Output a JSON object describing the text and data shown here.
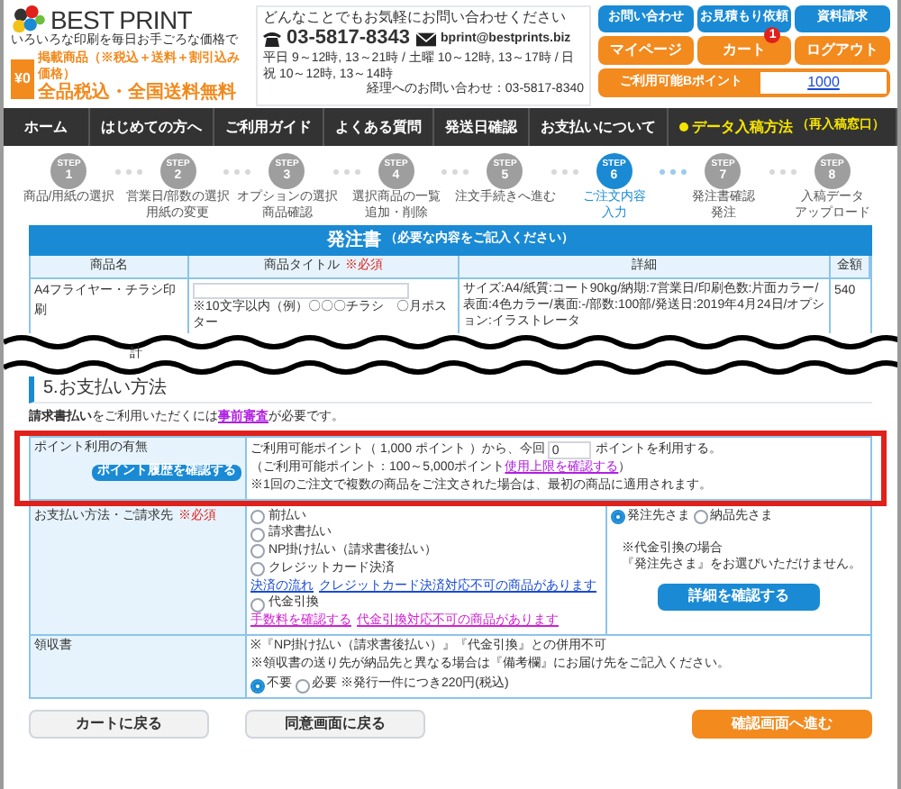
{
  "header": {
    "brand_first": "BEST",
    "brand_second": "PRINT",
    "tagline": "いろいろな印刷を毎日お手ごろな価格で",
    "badge": "¥0",
    "promo_small": "掲載商品（※税込＋送料＋割引込み価格）",
    "promo": "全品税込・全国送料無料"
  },
  "contact": {
    "headline": "どんなことでもお気軽にお問い合わせください",
    "phone": "03-5817-8343",
    "email": "bprint@bestprints.biz",
    "hours": "平日 9～12時, 13～21時 / 土曜 10～12時, 13～17時 / 日祝 10～12時, 13～14時",
    "accounting": "経理へのお問い合わせ：03-5817-8340"
  },
  "top_buttons": [
    {
      "label": "お問い合わせ",
      "kind": "blue"
    },
    {
      "label": "お見積もり依頼",
      "kind": "blue"
    },
    {
      "label": "資料請求",
      "kind": "blue"
    },
    {
      "label": "マイページ",
      "kind": "orange"
    },
    {
      "label": "カート",
      "kind": "orange",
      "badge": "1"
    },
    {
      "label": "ログアウト",
      "kind": "orange"
    }
  ],
  "points": {
    "label": "ご利用可能Bポイント",
    "value": "1000"
  },
  "nav": [
    {
      "label": "ホーム",
      "kind": "normal"
    },
    {
      "label": "はじめての方へ",
      "kind": "normal"
    },
    {
      "label": "ご利用ガイド",
      "kind": "normal"
    },
    {
      "label": "よくある質問",
      "kind": "normal"
    },
    {
      "label": "発送日確認",
      "kind": "normal"
    },
    {
      "label": "お支払いについて",
      "kind": "normal"
    },
    {
      "label": "データ入稿方法",
      "kind": "highlight",
      "sub": "（再入稿窓口）"
    }
  ],
  "steps": [
    {
      "label": "STEP",
      "number": "1",
      "caption": [
        "商品/用紙の選択"
      ],
      "selected": false
    },
    {
      "label": "STEP",
      "number": "2",
      "caption": [
        "営業日/部数の選択",
        "用紙の変更"
      ],
      "selected": false
    },
    {
      "label": "STEP",
      "number": "3",
      "caption": [
        "オプションの選択",
        "商品確認"
      ],
      "selected": false
    },
    {
      "label": "STEP",
      "number": "4",
      "caption": [
        "選択商品の一覧",
        "追加・削除"
      ],
      "selected": false
    },
    {
      "label": "STEP",
      "number": "5",
      "caption": [
        "注文手続きへ進む"
      ],
      "selected": false
    },
    {
      "label": "STEP",
      "number": "6",
      "caption": [
        "ご注文内容",
        "入力"
      ],
      "selected": true
    },
    {
      "label": "STEP",
      "number": "7",
      "caption": [
        "発注書確認",
        "発注"
      ],
      "selected": false
    },
    {
      "label": "STEP",
      "number": "8",
      "caption": [
        "入稿データ",
        "アップロード"
      ],
      "selected": false
    }
  ],
  "order_form": {
    "title": "発注書",
    "subtitle": "（必要な内容をご記入ください）",
    "columns": [
      {
        "label": "商品名"
      },
      {
        "label": "商品タイトル",
        "required": "※必須"
      },
      {
        "label": "詳細"
      },
      {
        "label": "金額"
      }
    ],
    "rows": [
      {
        "product": "A4フライヤー・チラシ印刷",
        "hint": "※10文字以内（例）〇〇〇チラシ　〇月ポスター",
        "details": "サイズ:A4/紙質:コート90kg/納期:7営業日/印刷色数:片面カラー/表面:4色カラー/裏面:-/部数:100部/発送日:2019年4月24日/オプション:イラストレータ",
        "amount": "540"
      }
    ],
    "total_label": "計"
  },
  "payment": {
    "section_title": "5.お支払い方法",
    "notice": {
      "text": "**請求書払い**をご利用いただくには",
      "link": "事前審査",
      "after": "が必要です。"
    },
    "points_row": {
      "label": "ポイント利用の有無",
      "history_button": "ポイント履歴を確認する",
      "use_before": "ご利用可能ポイント（ 1,000 ポイント ）から、今回",
      "use_value": "0",
      "use_after": "ポイントを利用する。",
      "range": "（ご利用可能ポイント：100～5,000ポイント",
      "range_link": "使用上限を確認する",
      "range_end": "）",
      "note": "※1回のご注文で複数の商品をご注文された場合は、最初の商品に適用されます。"
    },
    "method_row": {
      "label": "お支払い方法・ご請求先",
      "required": "※必須",
      "items": [
        {
          "kind": "radio",
          "label": "前払い",
          "selected": false
        },
        {
          "kind": "radio",
          "label": "請求書払い",
          "selected": false
        },
        {
          "kind": "radio",
          "label": "NP掛け払い（請求書後払い）",
          "selected": false
        },
        {
          "kind": "radio",
          "label": "クレジットカード決済",
          "selected": false
        },
        {
          "kind": "links",
          "links": [
            {
              "label": "決済の流れ",
              "visited": false
            },
            {
              "label": "クレジットカード決済対応不可の商品があります",
              "visited": false
            }
          ]
        },
        {
          "kind": "radio",
          "label": "代金引換",
          "selected": false
        },
        {
          "kind": "links",
          "links": [
            {
              "label": "手数料を確認する",
              "visited": true
            },
            {
              "label": "代金引換対応不可の商品があります",
              "visited": true
            }
          ]
        }
      ],
      "billing": [
        {
          "label": "発注先さま",
          "selected": true
        },
        {
          "label": "納品先さま",
          "selected": false
        }
      ],
      "billing_note": [
        "※代金引換の場合",
        "『発注先さま』をお選びいただけません。"
      ],
      "detail_button": "詳細を確認する"
    },
    "receipt_row": {
      "label": "領収書",
      "notes": [
        "※『NP掛け払い（請求書後払い）』『代金引換』との併用不可",
        "※領収書の送り先が納品先と異なる場合は『備考欄』にお届け先をご記入ください。"
      ],
      "options": [
        {
          "label": "不要",
          "selected": true
        },
        {
          "label": "必要",
          "selected": false
        }
      ],
      "option_note": "※発行一件につき220円(税込)"
    }
  },
  "bottom_buttons": [
    {
      "label": "カートに戻る",
      "kind": "plain"
    },
    {
      "label": "同意画面に戻る",
      "kind": "plain"
    },
    {
      "label": "確認画面へ進む",
      "kind": "primary"
    }
  ]
}
